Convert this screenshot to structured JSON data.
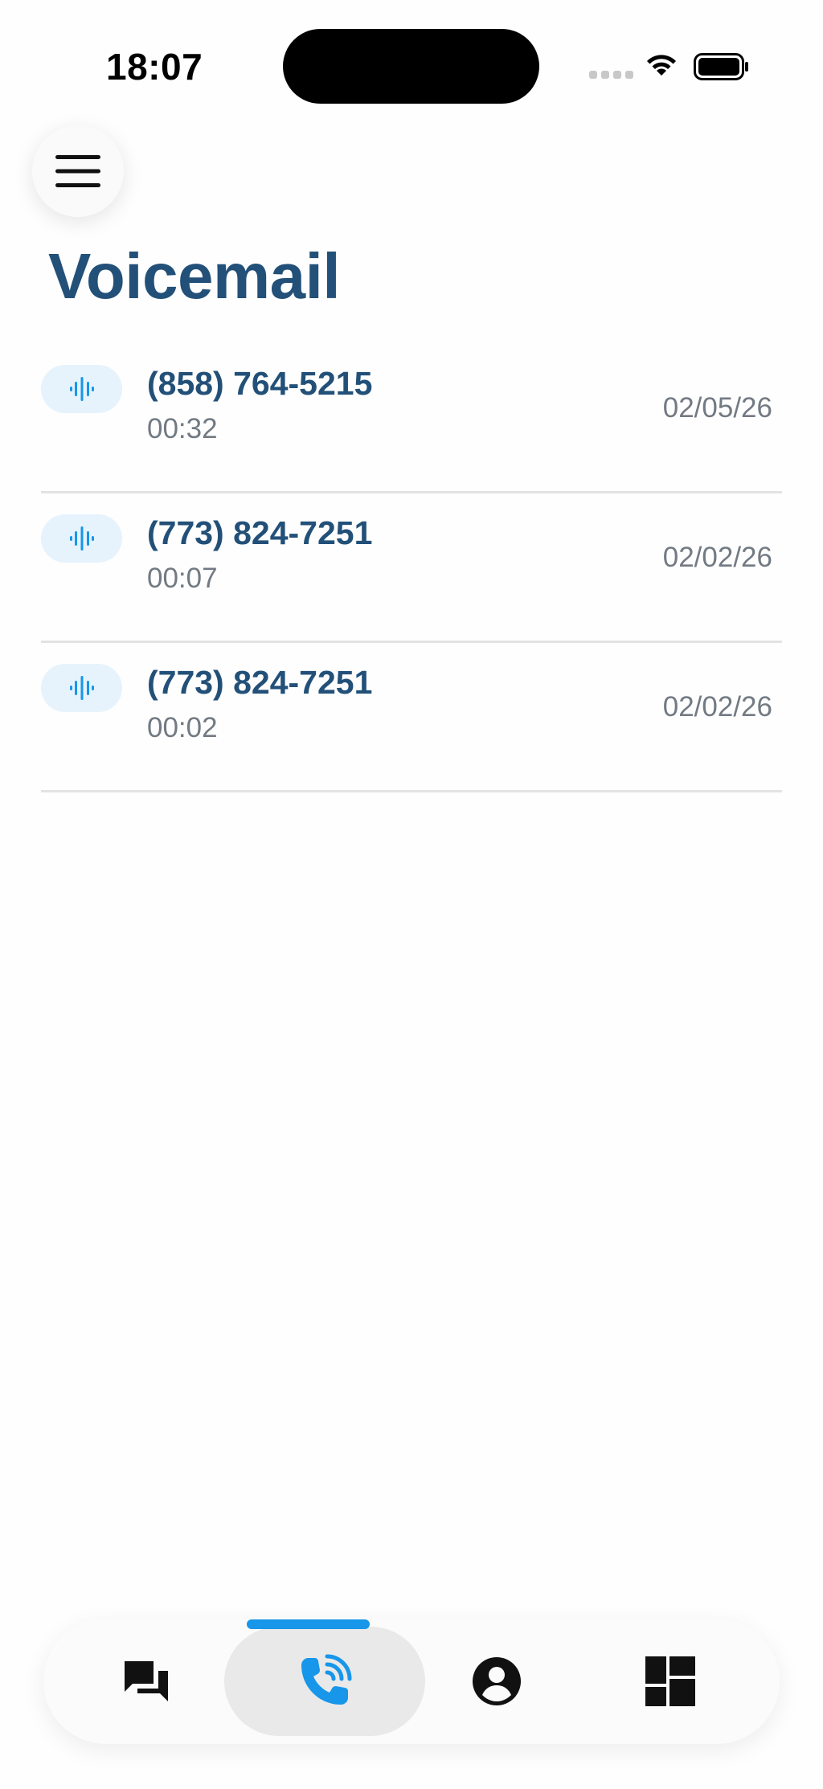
{
  "status_bar": {
    "time": "18:07"
  },
  "header": {
    "menu_icon": "hamburger-menu-icon",
    "title": "Voicemail"
  },
  "voicemails": [
    {
      "number": "(858) 764-5215",
      "duration": "00:32",
      "date": "02/05/26"
    },
    {
      "number": "(773) 824-7251",
      "duration": "00:07",
      "date": "02/02/26"
    },
    {
      "number": "(773) 824-7251",
      "duration": "00:02",
      "date": "02/02/26"
    }
  ],
  "bottom_nav": {
    "items": [
      {
        "icon": "chat-icon",
        "active": false
      },
      {
        "icon": "phone-call-icon",
        "active": true
      },
      {
        "icon": "account-icon",
        "active": false
      },
      {
        "icon": "dashboard-icon",
        "active": false
      }
    ]
  },
  "colors": {
    "title": "#225078",
    "accent": "#1796ea",
    "secondary_text": "#727a83",
    "voicemail_pill": "#e6f3fc"
  }
}
